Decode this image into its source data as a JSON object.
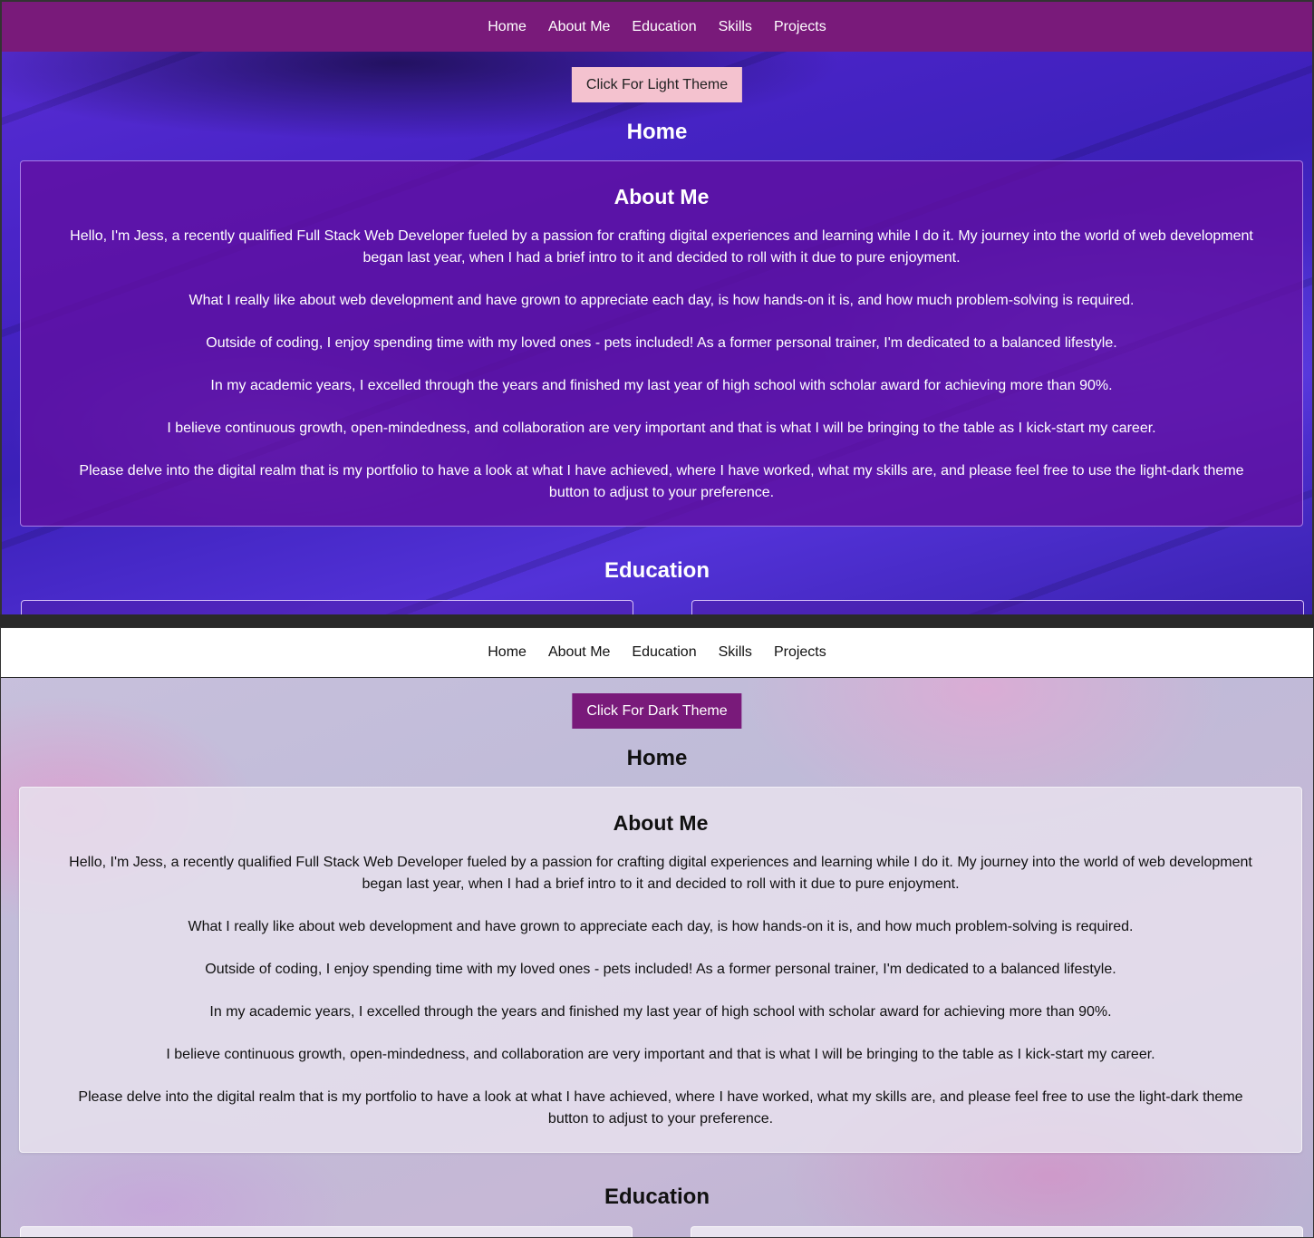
{
  "nav": {
    "items": [
      {
        "label": "Home"
      },
      {
        "label": "About Me"
      },
      {
        "label": "Education"
      },
      {
        "label": "Skills"
      },
      {
        "label": "Projects"
      }
    ]
  },
  "dark_view": {
    "theme_button": "Click For Light Theme",
    "colors": {
      "navbar": "#791a7a",
      "button": "#f4c2cf",
      "card": "#6210a0"
    }
  },
  "light_view": {
    "theme_button": "Click For Dark Theme",
    "colors": {
      "navbar": "#ffffff",
      "button": "#791a7a",
      "card": "#e8e2ee"
    }
  },
  "home": {
    "title": "Home"
  },
  "about": {
    "title": "About Me",
    "paragraphs": [
      "Hello, I'm Jess, a recently qualified Full Stack Web Developer fueled by a passion for crafting digital experiences and learning while I do it. My journey into the world of web development began last year, when I had a brief intro to it and decided to roll with it due to pure enjoyment.",
      "What I really like about web development and have grown to appreciate each day, is how hands-on it is, and how much problem-solving is required.",
      "Outside of coding, I enjoy spending time with my loved ones - pets included! As a former personal trainer, I'm dedicated to a balanced lifestyle.",
      "In my academic years, I excelled through the years and finished my last year of high school with scholar award for achieving more than 90%.",
      "I believe continuous growth, open-mindedness, and collaboration are very important and that is what I will be bringing to the table as I kick-start my career.",
      "Please delve into the digital realm that is my portfolio to have a look at what I have achieved, where I have worked, what my skills are, and please feel free to use the light-dark theme button to adjust to your preference."
    ]
  },
  "education": {
    "title": "Education"
  }
}
